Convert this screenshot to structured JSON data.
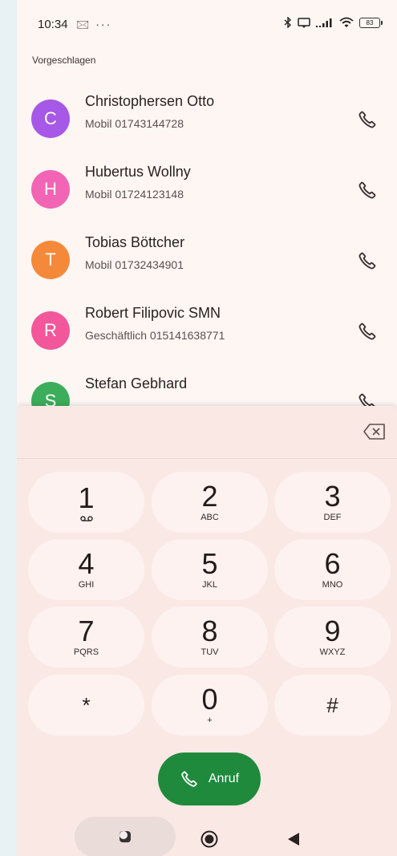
{
  "status_bar": {
    "time": "10:34",
    "left_icons": "🖂 ···",
    "battery": "83"
  },
  "section_label": "Vorgeschlagen",
  "contacts": [
    {
      "initial": "C",
      "name": "Christophersen Otto",
      "detail": "Mobil 01743144728",
      "color": "#a658e6"
    },
    {
      "initial": "H",
      "name": "Hubertus Wollny",
      "detail": "Mobil 01724123148",
      "color": "#f264b4"
    },
    {
      "initial": "T",
      "name": "Tobias Böttcher",
      "detail": "Mobil 01732434901",
      "color": "#f5893a"
    },
    {
      "initial": "R",
      "name": "Robert Filipovic SMN",
      "detail": "Geschäftlich 015141638771",
      "color": "#f1579a"
    },
    {
      "initial": "S",
      "name": "Stefan Gebhard",
      "detail": "",
      "color": "#3cad5a"
    }
  ],
  "dialpad": {
    "keys": [
      {
        "digit": "1",
        "letters": ""
      },
      {
        "digit": "2",
        "letters": "ABC"
      },
      {
        "digit": "3",
        "letters": "DEF"
      },
      {
        "digit": "4",
        "letters": "GHI"
      },
      {
        "digit": "5",
        "letters": "JKL"
      },
      {
        "digit": "6",
        "letters": "MNO"
      },
      {
        "digit": "7",
        "letters": "PQRS"
      },
      {
        "digit": "8",
        "letters": "TUV"
      },
      {
        "digit": "9",
        "letters": "WXYZ"
      },
      {
        "digit": "*",
        "letters": ""
      },
      {
        "digit": "0",
        "letters": "+"
      },
      {
        "digit": "#",
        "letters": ""
      }
    ],
    "call_label": "Anruf",
    "call_color": "#1f8a3c"
  },
  "icons": {
    "voicemail": "voicemail-icon",
    "call": "phone-icon",
    "backspace": "backspace-icon"
  }
}
